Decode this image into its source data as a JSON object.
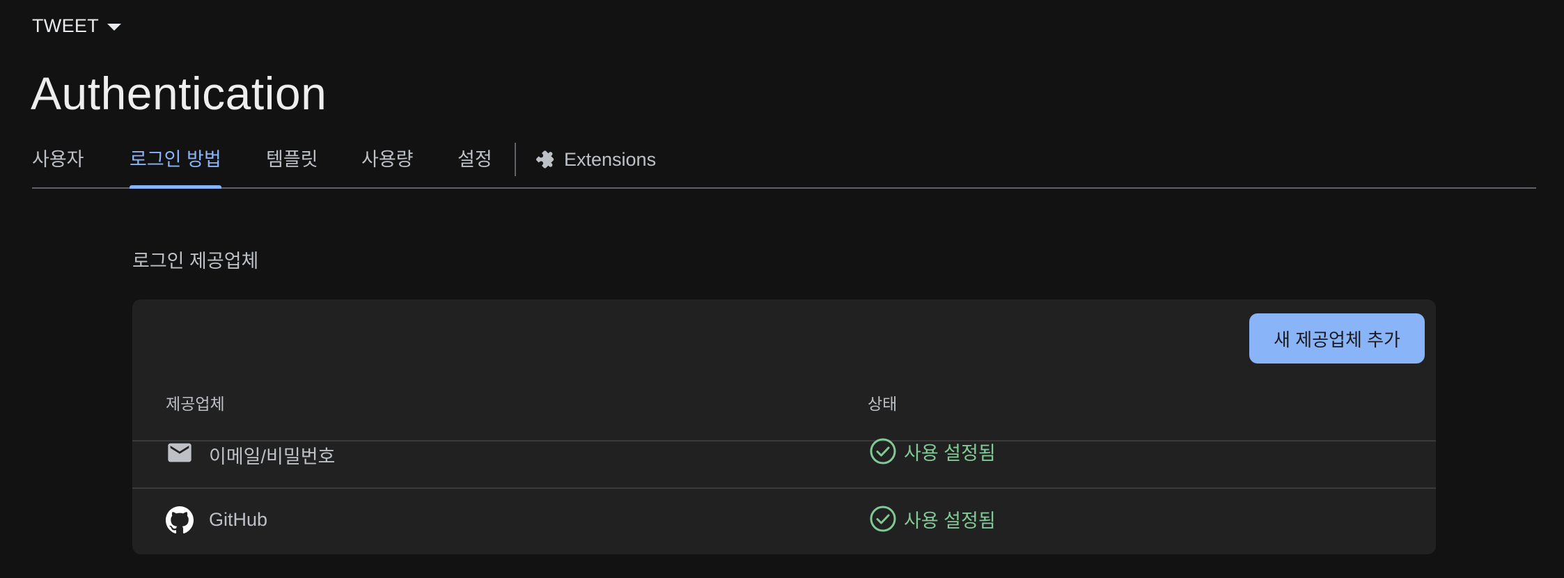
{
  "project": {
    "name": "TWEET"
  },
  "page": {
    "title": "Authentication"
  },
  "tabs": [
    {
      "label": "사용자",
      "active": false
    },
    {
      "label": "로그인 방법",
      "active": true
    },
    {
      "label": "템플릿",
      "active": false
    },
    {
      "label": "사용량",
      "active": false
    },
    {
      "label": "설정",
      "active": false
    },
    {
      "label": "Extensions",
      "active": false,
      "icon": "puzzle-icon"
    }
  ],
  "section": {
    "label": "로그인 제공업체"
  },
  "card": {
    "add_button_label": "새 제공업체 추가",
    "columns": {
      "provider": "제공업체",
      "status": "상태"
    },
    "rows": [
      {
        "provider": "이메일/비밀번호",
        "icon": "mail-icon",
        "status": "사용 설정됨"
      },
      {
        "provider": "GitHub",
        "icon": "github-icon",
        "status": "사용 설정됨"
      }
    ]
  },
  "colors": {
    "background": "#121212",
    "card": "#212121",
    "accent": "#8ab4f8",
    "enabled": "#81c995"
  }
}
